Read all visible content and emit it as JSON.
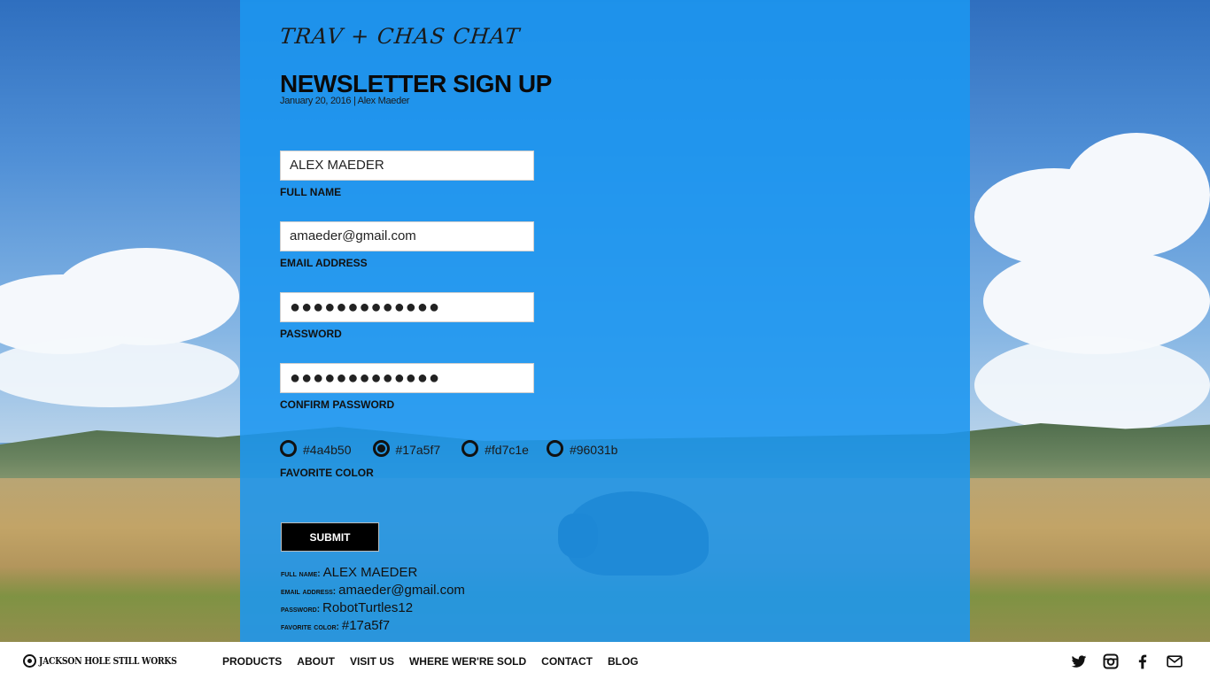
{
  "blog_title": "TRAV + CHAS CHAT",
  "page_title": "NEWSLETTER SIGN UP",
  "meta": "January 20, 2016 | Alex Maeder",
  "form": {
    "full_name": {
      "value": "ALEX MAEDER",
      "label": "FULL NAME"
    },
    "email": {
      "value": "amaeder@gmail.com",
      "label": "EMAIL ADDRESS"
    },
    "password": {
      "value": "●●●●●●●●●●●●●",
      "label": "PASSWORD"
    },
    "confirm_password": {
      "value": "●●●●●●●●●●●●●",
      "label": "CONFIRM PASSWORD"
    },
    "favorite_color": {
      "label": "FAVORITE COLOR",
      "options": [
        "#4a4b50",
        "#17a5f7",
        "#fd7c1e",
        "#96031b"
      ],
      "selected": "#17a5f7"
    },
    "submit_label": "SUBMIT"
  },
  "summary": {
    "full_name_key": "full name:",
    "full_name_val": "ALEX MAEDER",
    "email_key": "email address:",
    "email_val": "amaeder@gmail.com",
    "password_key": "password:",
    "password_val": "RobotTurtles12",
    "color_key": "favorite color:",
    "color_val": "#17a5f7"
  },
  "nav": {
    "logo_text": "JACKSON HOLE STILL WORKS",
    "items": [
      "PRODUCTS",
      "ABOUT",
      "VISIT US",
      "WHERE WER'RE SOLD",
      "CONTACT",
      "BLOG"
    ],
    "social_icons": [
      "twitter-icon",
      "instagram-icon",
      "facebook-icon",
      "mail-icon"
    ]
  },
  "colors": {
    "panel": "#1b96f0",
    "text": "#111111",
    "button": "#000000",
    "nav_bg": "#ffffff"
  }
}
